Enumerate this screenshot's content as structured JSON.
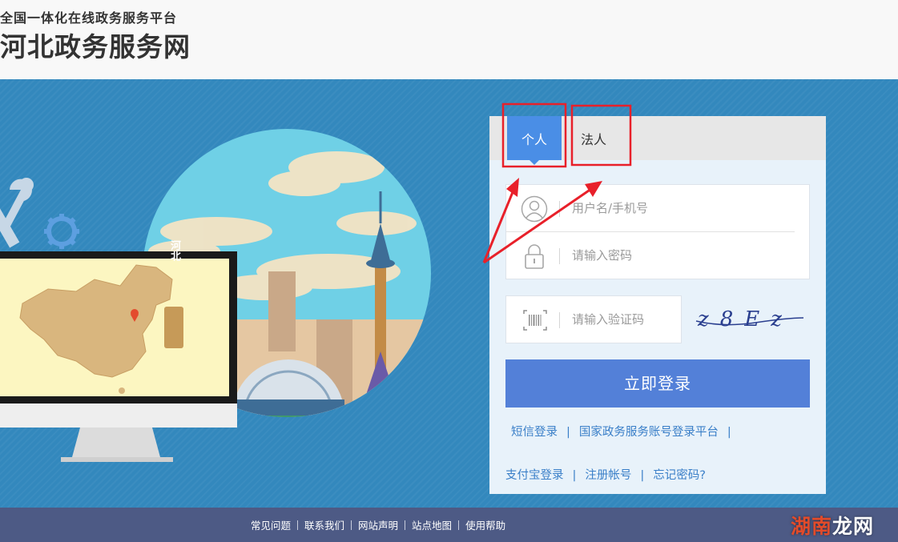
{
  "header": {
    "subtitle": "全国一体化在线政务服务平台",
    "title": "河北政务服务网"
  },
  "illustration": {
    "map_label": "河北"
  },
  "login": {
    "tabs": [
      {
        "label": "个人",
        "active": true
      },
      {
        "label": "法人",
        "active": false
      }
    ],
    "username_placeholder": "用户名/手机号",
    "password_placeholder": "请输入密码",
    "captcha_placeholder": "请输入验证码",
    "captcha_text": "z8Ez",
    "submit_label": "立即登录",
    "links_row1": [
      "短信登录",
      "国家政务服务账号登录平台"
    ],
    "links_row2": [
      "支付宝登录",
      "注册帐号",
      "忘记密码?"
    ]
  },
  "footer": {
    "links": [
      "常见问题",
      "联系我们",
      "网站声明",
      "站点地图",
      "使用帮助"
    ]
  },
  "watermark": {
    "highlight": "湖南",
    "rest": "龙网"
  },
  "colors": {
    "banner_bg": "#3388bd",
    "tab_active": "#4a8ee6",
    "login_button": "#5380d8",
    "link": "#3a7fc8",
    "footer_bg": "#4d5a85",
    "annotation_red": "#e8202a"
  }
}
